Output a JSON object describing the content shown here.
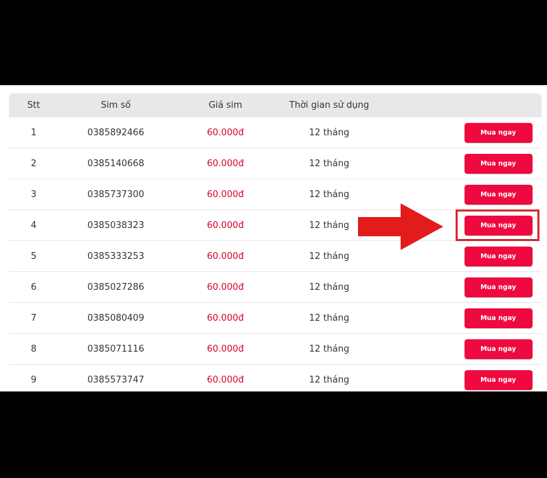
{
  "colors": {
    "accent": "#ee0a3f",
    "price": "#d6002a",
    "header_bg": "#e8e8e8",
    "annotation": "#e21b1b"
  },
  "table": {
    "headers": {
      "stt": "Stt",
      "sim": "Sim số",
      "price": "Giá sim",
      "duration": "Thời gian sử dụng"
    },
    "rows": [
      {
        "stt": "1",
        "sim": "0385892466",
        "price": "60.000đ",
        "duration": "12 tháng",
        "button": "Mua ngay"
      },
      {
        "stt": "2",
        "sim": "0385140668",
        "price": "60.000đ",
        "duration": "12 tháng",
        "button": "Mua ngay"
      },
      {
        "stt": "3",
        "sim": "0385737300",
        "price": "60.000đ",
        "duration": "12 tháng",
        "button": "Mua ngay"
      },
      {
        "stt": "4",
        "sim": "0385038323",
        "price": "60.000đ",
        "duration": "12 tháng",
        "button": "Mua ngay"
      },
      {
        "stt": "5",
        "sim": "0385333253",
        "price": "60.000đ",
        "duration": "12 tháng",
        "button": "Mua ngay"
      },
      {
        "stt": "6",
        "sim": "0385027286",
        "price": "60.000đ",
        "duration": "12 tháng",
        "button": "Mua ngay"
      },
      {
        "stt": "7",
        "sim": "0385080409",
        "price": "60.000đ",
        "duration": "12 tháng",
        "button": "Mua ngay"
      },
      {
        "stt": "8",
        "sim": "0385071116",
        "price": "60.000đ",
        "duration": "12 tháng",
        "button": "Mua ngay"
      },
      {
        "stt": "9",
        "sim": "0385573747",
        "price": "60.000đ",
        "duration": "12 tháng",
        "button": "Mua ngay"
      }
    ]
  },
  "annotation": {
    "highlighted_row": "4",
    "arrow_icon": "right-arrow-icon"
  }
}
